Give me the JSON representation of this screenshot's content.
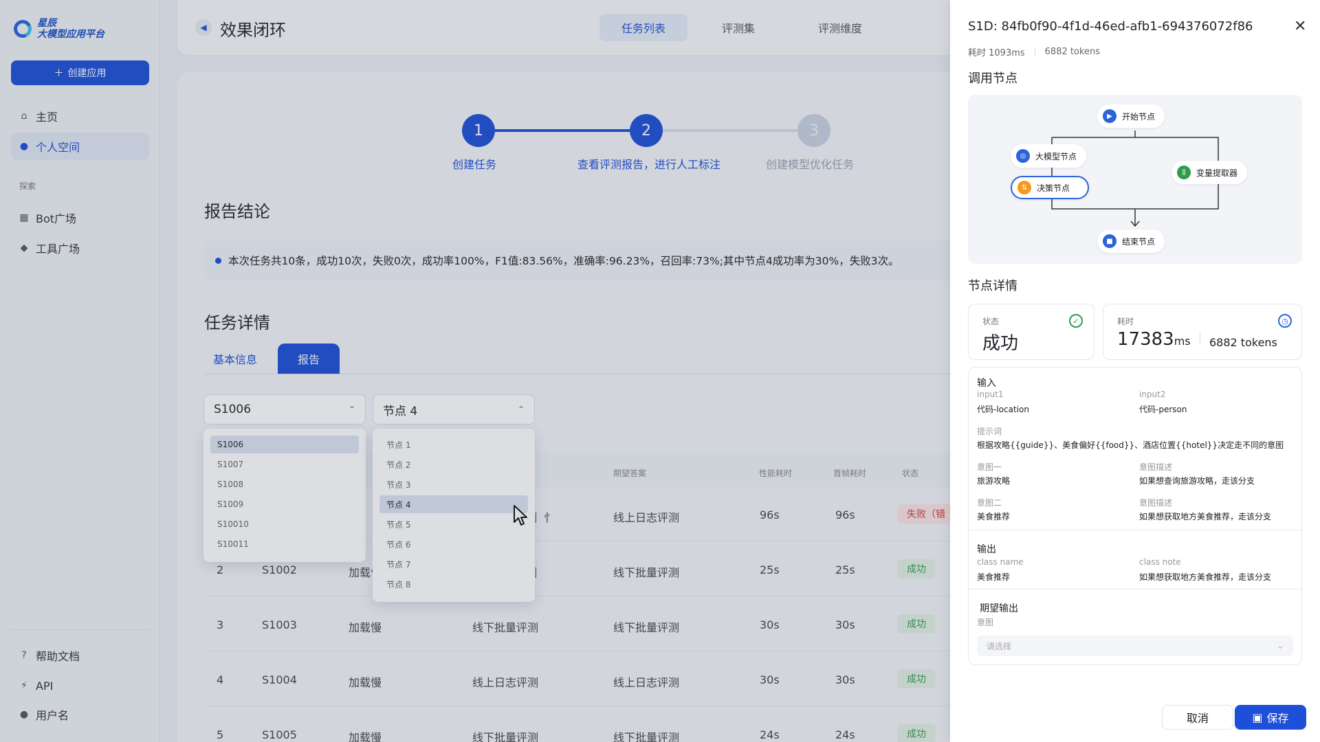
{
  "sidebar": {
    "logo_line1": "星辰",
    "logo_line2": "大模型应用平台",
    "create_button": "创建应用",
    "nav": [
      "主页",
      "个人空间"
    ],
    "explore_label": "探索",
    "explore_items": [
      "Bot广场",
      "工具广场"
    ],
    "footer_items": [
      "帮助文档",
      "API",
      "用户名"
    ]
  },
  "header": {
    "title": "效果闭环",
    "tabs": [
      "任务列表",
      "评测集",
      "评测维度"
    ]
  },
  "steps": [
    {
      "num": "1",
      "label": "创建任务"
    },
    {
      "num": "2",
      "label": "查看评测报告，进行人工标注"
    },
    {
      "num": "3",
      "label": "创建模型优化任务"
    }
  ],
  "report": {
    "title": "报告结论",
    "text": "本次任务共10条，成功10次，失败0次，成功率100%，F1值:83.56%，准确率:96.23%，召回率:73%;其中节点4成功率为30%，失败3次。"
  },
  "task": {
    "title": "任务详情",
    "tabs": [
      "基本信息",
      "报告"
    ],
    "select_sid": "S1006",
    "select_node": "节点 4",
    "sid_options": [
      "S1006",
      "S1007",
      "S1008",
      "S1009",
      "S10010",
      "S10011"
    ],
    "node_options": [
      "节点 1",
      "节点 2",
      "节点 3",
      "节点 4",
      "节点 5",
      "节点 6",
      "节点 7",
      "节点 8"
    ],
    "headers": [
      "期望答案",
      "性能耗时",
      "首帧耗时",
      "状态"
    ],
    "rows": [
      {
        "idx": "",
        "sid": "",
        "c1": "",
        "c2": "",
        "c3": "线上日志评测",
        "t1": "96s",
        "t2": "96s",
        "status": "失败（错"
      },
      {
        "idx": "2",
        "sid": "S1002",
        "c1": "加载慢",
        "c2": "",
        "c3": "线下批量评测",
        "t1": "25s",
        "t2": "25s",
        "status": "成功"
      },
      {
        "idx": "3",
        "sid": "S1003",
        "c1": "加载慢",
        "c2": "线下批量评测",
        "c3": "线下批量评测",
        "t1": "30s",
        "t2": "30s",
        "status": "成功"
      },
      {
        "idx": "4",
        "sid": "S1004",
        "c1": "加载慢",
        "c2": "线上日志评测",
        "c3": "线上日志评测",
        "t1": "30s",
        "t2": "30s",
        "status": "成功"
      },
      {
        "idx": "5",
        "sid": "S1005",
        "c1": "加载慢",
        "c2": "线下批量评测",
        "c3": "线下批量评测",
        "t1": "24s",
        "t2": "24s",
        "status": "成功"
      }
    ],
    "partial_c1_row1": "忄",
    "partial_c2_row1": "测",
    "partial_c2_row2": "测",
    "partial_c1_row2": "加载忄"
  },
  "panel": {
    "title": "S1D: 84fb0f90-4f1d-46ed-afb1-694376072f86",
    "meta_time": "耗时  1093ms",
    "meta_tokens": "6882  tokens",
    "call_nodes_title": "调用节点",
    "flow_nodes": {
      "start": "开始节点",
      "llm": "大模型节点",
      "decision": "决策节点",
      "extractor": "变量提取器",
      "end": "结束节点"
    },
    "node_detail_title": "节点详情",
    "status_label": "状态",
    "status_value": "成功",
    "time_label": "耗时",
    "time_value": "17383",
    "time_unit": "ms",
    "time_tokens": "6882 tokens",
    "input_title": "输入",
    "input1_label": "input1",
    "input1_value": "代码-location",
    "input2_label": "input2",
    "input2_value": "代码-person",
    "prompt_label": "提示词",
    "prompt_value": "根据攻略{{guide}}、美食偏好{{food}}、酒店位置{{hotel}}决定走不同的意图",
    "intent1_label": "意图一",
    "intent1_value": "旅游攻略",
    "intent1_desc_label": "意图描述",
    "intent1_desc_value": "如果想查询旅游攻略，走该分支",
    "intent2_label": "意图二",
    "intent2_value": "美食推荐",
    "intent2_desc_label": "意图描述",
    "intent2_desc_value": "如果想获取地方美食推荐，走该分支",
    "output_title": "输出",
    "class_name_label": "class name",
    "class_name_value": "美食推荐",
    "class_note_label": "class note",
    "class_note_value": "如果想获取地方美食推荐，走该分支",
    "expected_title": "期望输出",
    "intent_label": "意图",
    "intent_placeholder": "请选择",
    "cancel": "取消",
    "save": "保存"
  },
  "colors": {
    "primary": "#1d4fd8",
    "success": "#2f9b4b",
    "danger": "#d23c3c"
  }
}
